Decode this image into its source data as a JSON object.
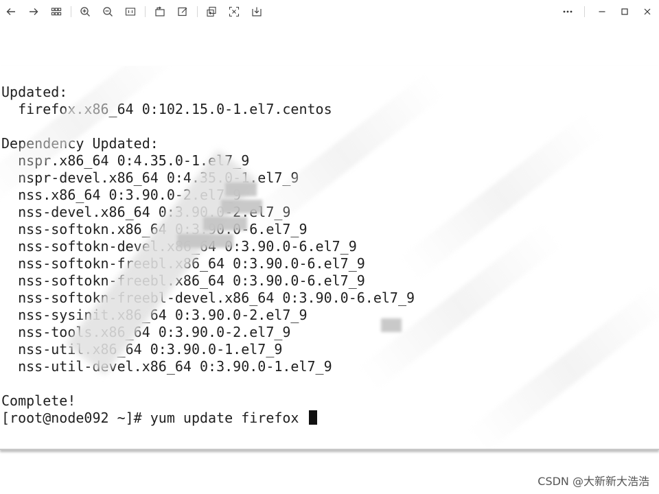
{
  "toolbar": {
    "left_icons": [
      "back-icon",
      "forward-icon",
      "grid-icon",
      "zoom-in-icon",
      "zoom-out-icon",
      "actual-size-icon",
      "rotate-icon",
      "edit-icon",
      "copy-icon",
      "crop-icon",
      "download-icon"
    ],
    "right_icons": [
      "more-icon",
      "minimize-icon",
      "maximize-icon",
      "close-icon"
    ]
  },
  "terminal": {
    "lines": [
      "Updated:",
      "  firefox.x86_64 0:102.15.0-1.el7.centos",
      "",
      "Dependency Updated:",
      "  nspr.x86_64 0:4.35.0-1.el7_9",
      "  nspr-devel.x86_64 0:4.35.0-1.el7_9",
      "  nss.x86_64 0:3.90.0-2.el7_9",
      "  nss-devel.x86_64 0:3.90.0-2.el7_9",
      "  nss-softokn.x86_64 0:3.90.0-6.el7_9",
      "  nss-softokn-devel.x86_64 0:3.90.0-6.el7_9",
      "  nss-softokn-freebl.x86_64 0:3.90.0-6.el7_9",
      "  nss-softokn-freebl.x86_64 0:3.90.0-6.el7_9",
      "  nss-softokn-freebl-devel.x86_64 0:3.90.0-6.el7_9",
      "  nss-sysinit.x86_64 0:3.90.0-2.el7_9",
      "  nss-tools.x86_64 0:3.90.0-2.el7_9",
      "  nss-util.x86_64 0:3.90.0-1.el7_9",
      "  nss-util-devel.x86_64 0:3.90.0-1.el7_9",
      "",
      "Complete!"
    ],
    "prompt": "[root@node092 ~]# yum update firefox "
  },
  "watermark": "CSDN @大新新大浩浩"
}
